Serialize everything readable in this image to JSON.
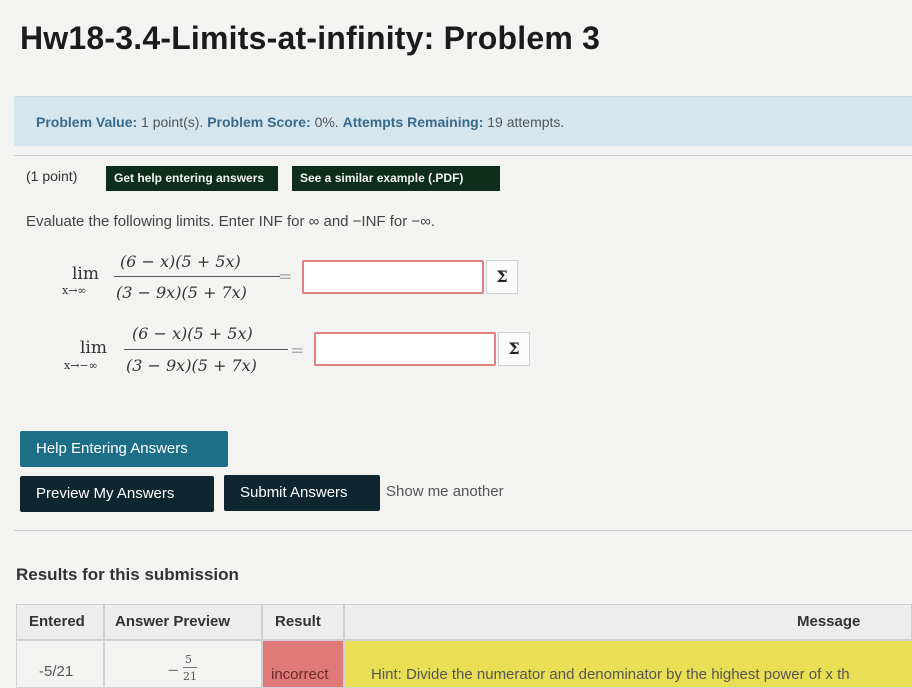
{
  "page": {
    "title": "Hw18-3.4-Limits-at-infinity: Problem 3"
  },
  "info": {
    "value_label": "Problem Value:",
    "value": "1 point(s).",
    "score_label": "Problem Score:",
    "score": "0%.",
    "attempts_label": "Attempts Remaining:",
    "attempts": "19 attempts."
  },
  "problem": {
    "points": "(1 point)",
    "help_pill": "Get help entering answers",
    "example_pill": "See a similar example (.PDF)",
    "instruction": "Evaluate the following limits. Enter INF for ∞ and −INF for −∞.",
    "limits": [
      {
        "lim": "lim",
        "sub": "x→∞",
        "numerator": "(6 − x)(5 + 5x)",
        "denominator": "(3 − 9x)(5 + 7x)",
        "eq": "=",
        "value": "",
        "sigma": "Σ"
      },
      {
        "lim": "lim",
        "sub": "x→−∞",
        "numerator": "(6 − x)(5 + 5x)",
        "denominator": "(3 − 9x)(5 + 7x)",
        "eq": "=",
        "value": "",
        "sigma": "Σ"
      }
    ]
  },
  "buttons": {
    "help": "Help Entering Answers",
    "preview": "Preview My Answers",
    "submit": "Submit Answers",
    "show_another": "Show me another"
  },
  "results": {
    "title": "Results for this submission",
    "headers": [
      "Entered",
      "Answer Preview",
      "Result",
      "Message"
    ],
    "row": {
      "entered": "-5/21",
      "preview_num": "5",
      "preview_den": "21",
      "result": "incorrect",
      "message": "Hint: Divide the numerator and denominator by the highest power of x th"
    }
  },
  "colors": {
    "info_bar": "#d6e6ee",
    "incorrect": "#e07a78",
    "hint": "#e9de54",
    "help_button": "#1d6f88",
    "dark_button": "#0f2630"
  }
}
